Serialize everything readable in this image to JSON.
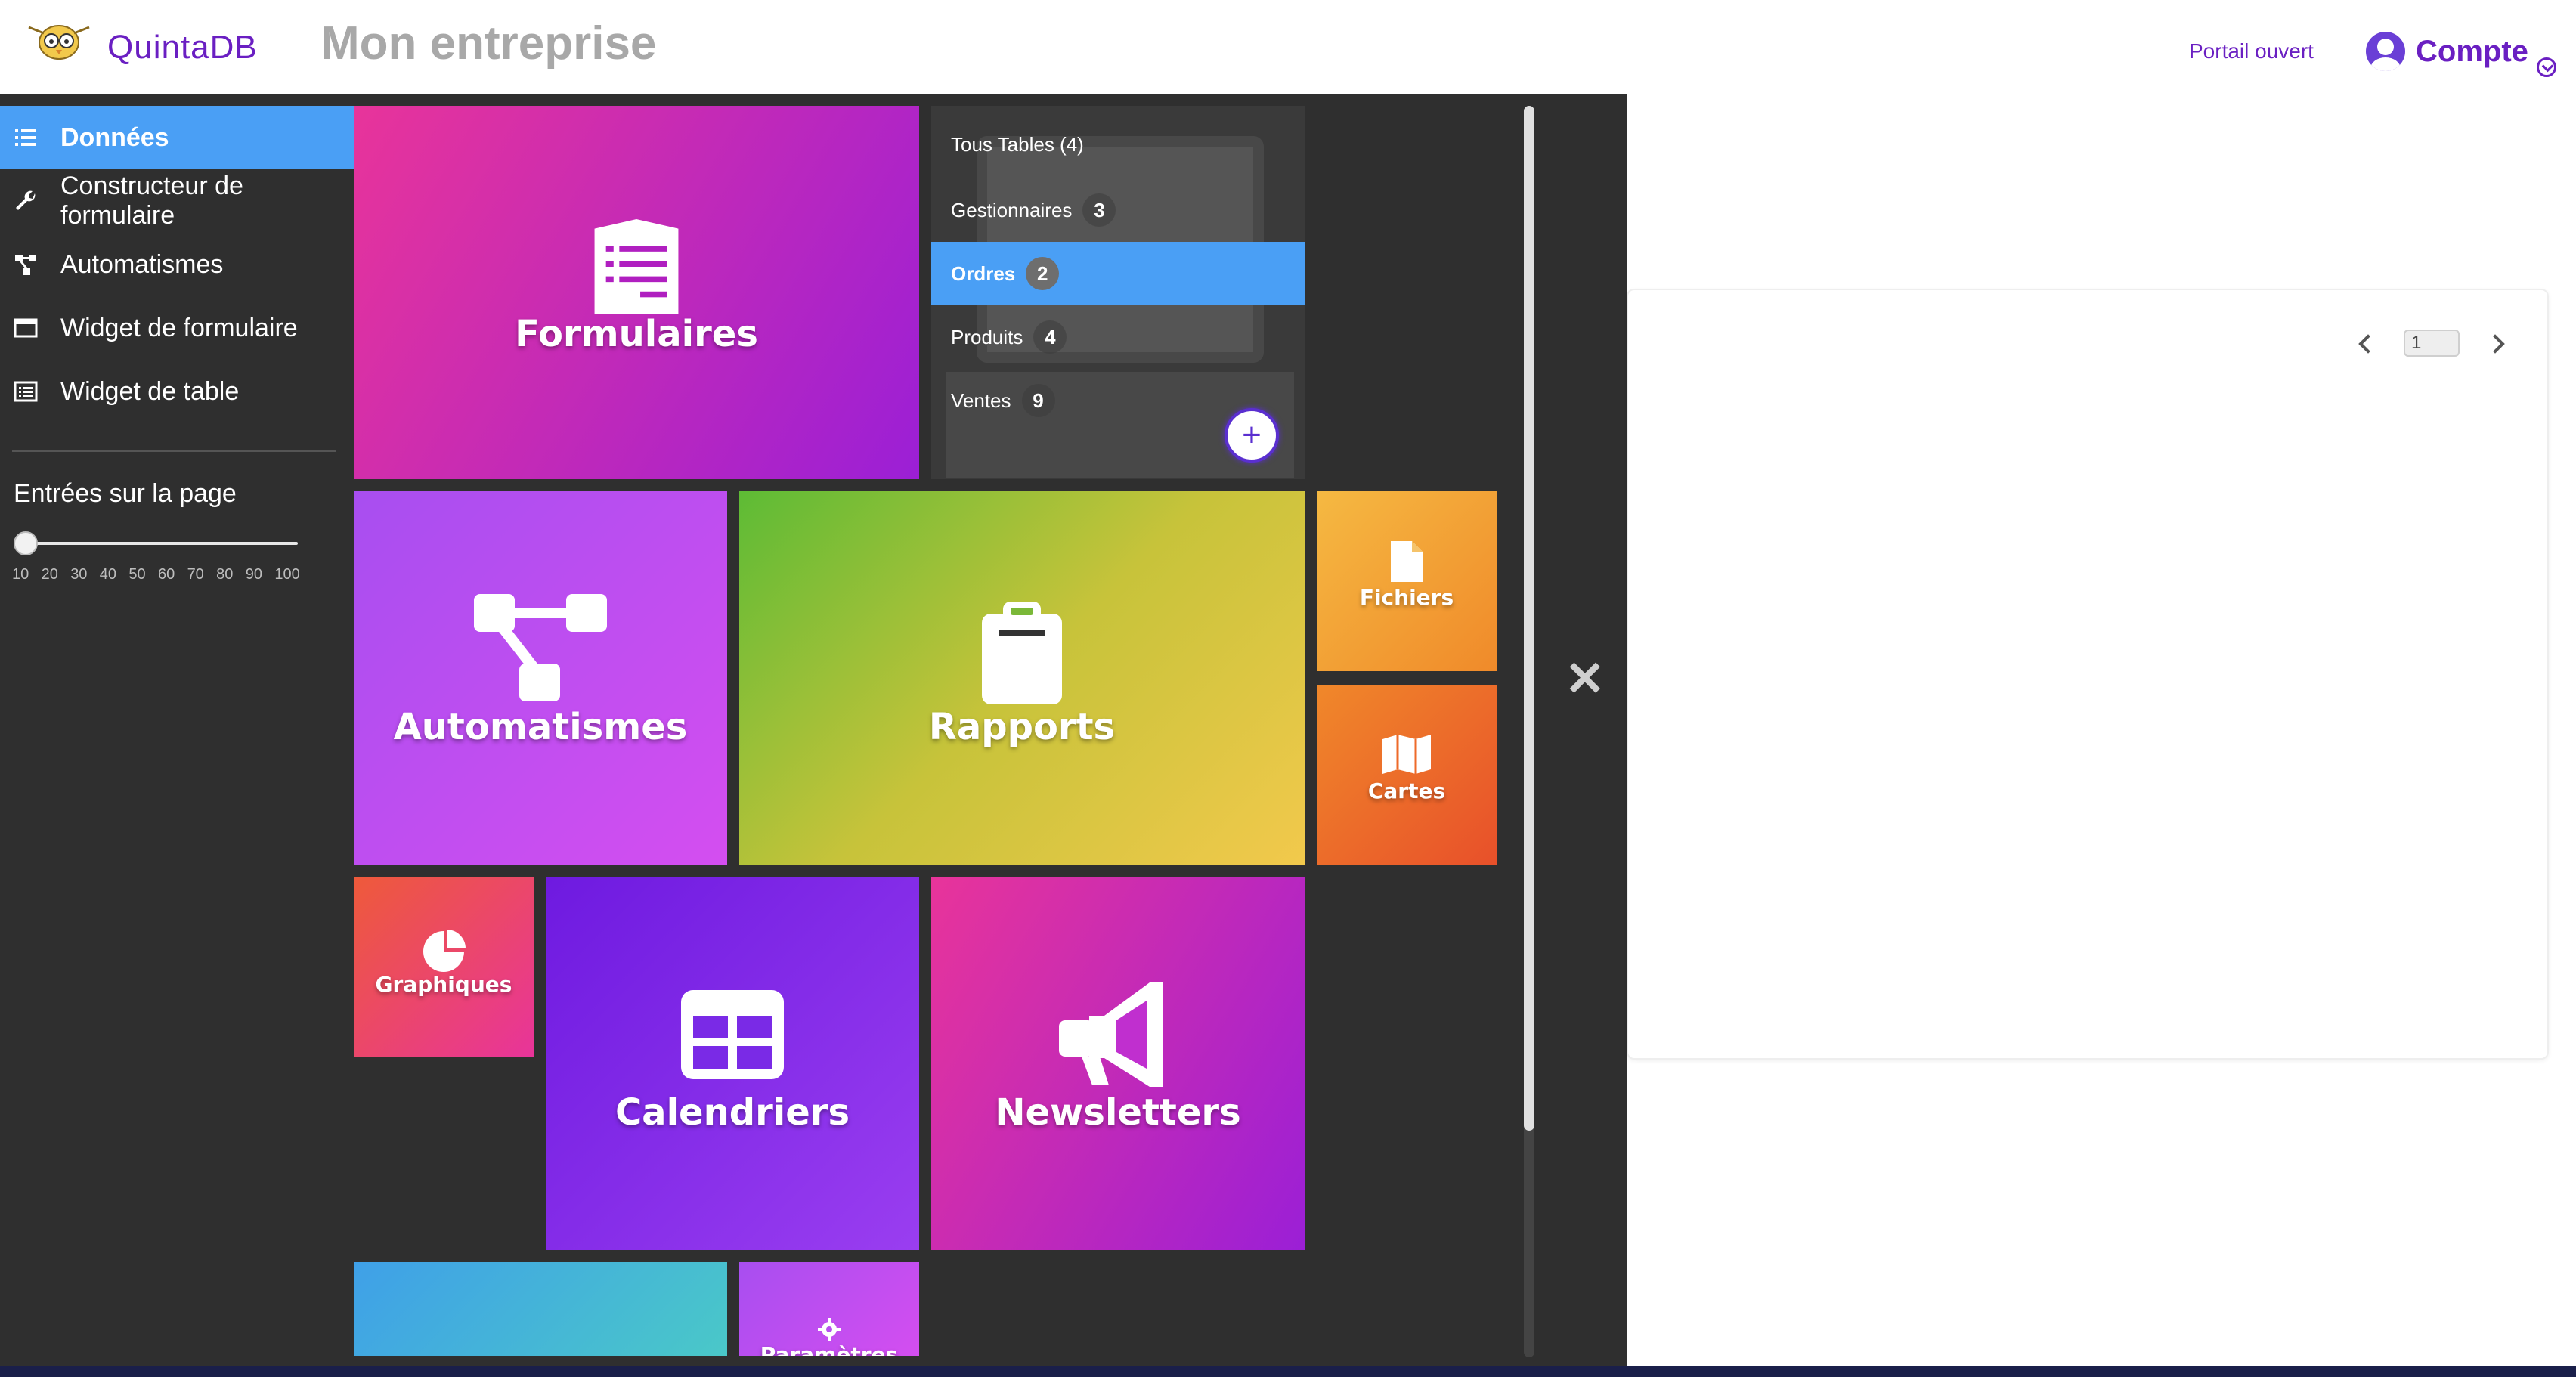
{
  "header": {
    "logo_text": "QuintaDB",
    "company": "Mon entreprise",
    "portal_link": "Portail ouvert",
    "account_label": "Compte"
  },
  "sidebar": {
    "items": [
      {
        "label": "Données",
        "icon": "list-icon",
        "active": true
      },
      {
        "label": "Constructeur de formulaire",
        "icon": "wrench-icon",
        "active": false
      },
      {
        "label": "Automatismes",
        "icon": "workflow-icon",
        "active": false
      },
      {
        "label": "Widget de formulaire",
        "icon": "window-icon",
        "active": false
      },
      {
        "label": "Widget de table",
        "icon": "table-list-icon",
        "active": false
      }
    ],
    "entries_title": "Entrées sur la page",
    "entries_value": 10,
    "entries_ticks": [
      "10",
      "20",
      "30",
      "40",
      "50",
      "60",
      "70",
      "80",
      "90",
      "100"
    ]
  },
  "tiles": {
    "formulaires": "Formulaires",
    "automatismes": "Automatismes",
    "rapports": "Rapports",
    "fichiers": "Fichiers",
    "cartes": "Cartes",
    "graphiques": "Graphiques",
    "calendriers": "Calendriers",
    "newsletters": "Newsletters",
    "parametres": "Paramètres"
  },
  "tables": {
    "title": "Tous Tables (4)",
    "rows": [
      {
        "name": "Gestionnaires",
        "count": "3",
        "active": false
      },
      {
        "name": "Ordres",
        "count": "2",
        "active": true
      },
      {
        "name": "Produits",
        "count": "4",
        "active": false
      },
      {
        "name": "Ventes",
        "count": "9",
        "active": false
      }
    ],
    "add_label": "+"
  },
  "pager": {
    "page": "1"
  },
  "colors": {
    "accent": "#6a1fc2",
    "active_blue": "#4a9ff5",
    "overlay_bg": "#2f2f2f"
  }
}
